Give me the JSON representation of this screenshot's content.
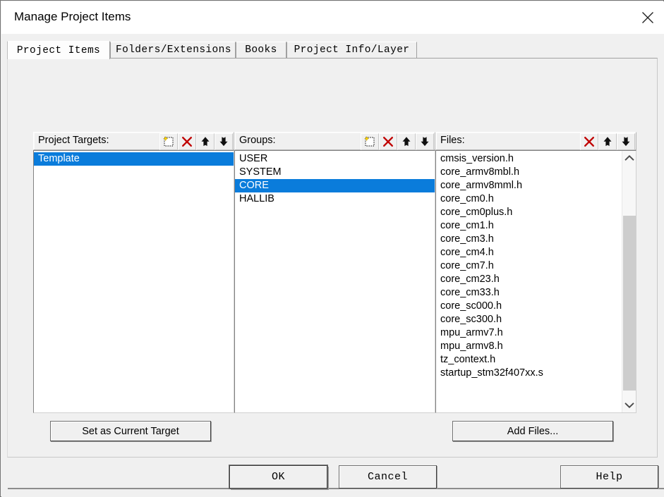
{
  "window": {
    "title": "Manage Project Items",
    "close_icon": "close-icon"
  },
  "tabs": [
    {
      "label": "Project Items",
      "active": true
    },
    {
      "label": "Folders/Extensions",
      "active": false
    },
    {
      "label": "Books",
      "active": false
    },
    {
      "label": "Project Info/Layer",
      "active": false
    }
  ],
  "panes": {
    "targets": {
      "label": "Project Targets:",
      "tools": [
        "new-icon",
        "delete-icon",
        "move-up-icon",
        "move-down-icon"
      ],
      "items": [
        {
          "name": "Template",
          "selected": true
        }
      ]
    },
    "groups": {
      "label": "Groups:",
      "tools": [
        "new-icon",
        "delete-icon",
        "move-up-icon",
        "move-down-icon"
      ],
      "items": [
        {
          "name": "USER",
          "selected": false
        },
        {
          "name": "SYSTEM",
          "selected": false
        },
        {
          "name": "CORE",
          "selected": true
        },
        {
          "name": "HALLIB",
          "selected": false
        }
      ]
    },
    "files": {
      "label": "Files:",
      "tools": [
        "delete-icon",
        "move-up-icon",
        "move-down-icon"
      ],
      "items": [
        {
          "name": "cmsis_version.h",
          "selected": false
        },
        {
          "name": "core_armv8mbl.h",
          "selected": false
        },
        {
          "name": "core_armv8mml.h",
          "selected": false
        },
        {
          "name": "core_cm0.h",
          "selected": false
        },
        {
          "name": "core_cm0plus.h",
          "selected": false
        },
        {
          "name": "core_cm1.h",
          "selected": false
        },
        {
          "name": "core_cm3.h",
          "selected": false
        },
        {
          "name": "core_cm4.h",
          "selected": false
        },
        {
          "name": "core_cm7.h",
          "selected": false
        },
        {
          "name": "core_cm23.h",
          "selected": false
        },
        {
          "name": "core_cm33.h",
          "selected": false
        },
        {
          "name": "core_sc000.h",
          "selected": false
        },
        {
          "name": "core_sc300.h",
          "selected": false
        },
        {
          "name": "mpu_armv7.h",
          "selected": false
        },
        {
          "name": "mpu_armv8.h",
          "selected": false
        },
        {
          "name": "tz_context.h",
          "selected": false
        },
        {
          "name": "startup_stm32f407xx.s",
          "selected": false
        }
      ],
      "scrollbar": {
        "up_icon": "chevron-up-icon",
        "down_icon": "chevron-down-icon",
        "thumb_top_pct": 25,
        "thumb_height_pct": 68
      }
    }
  },
  "actions": {
    "set_current_target": "Set as Current Target",
    "add_files": "Add Files..."
  },
  "footer": {
    "ok": "OK",
    "cancel": "Cancel",
    "help": "Help"
  },
  "colors": {
    "selection_blue": "#0a7cdb",
    "dialog_face": "#f0f0f0",
    "delete_red": "#c00000",
    "new_yellow": "#ffd700",
    "window_border": "#757575"
  }
}
